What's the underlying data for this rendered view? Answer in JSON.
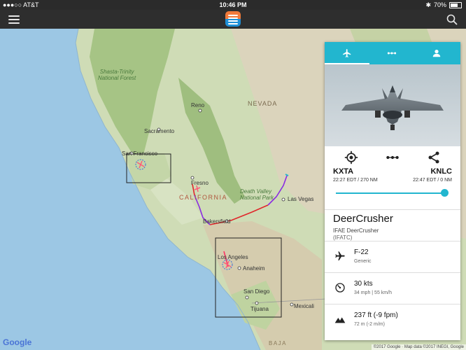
{
  "status_bar": {
    "carrier": "●●●○○ AT&T",
    "time": "10:46 PM",
    "battery": "70%",
    "battery_level": 0.7
  },
  "map": {
    "labels": {
      "shasta": "Shasta-Trinity\nNational Forest",
      "reno": "Reno",
      "nevada": "NEVADA",
      "sacramento": "Sacramento",
      "san_francisco": "San Francisco",
      "fresno": "Fresno",
      "california": "CALIFORNIA",
      "death_valley": "Death Valley\nNational Park",
      "las_vegas": "Las Vegas",
      "bakersfield": "Bakersfield",
      "los_angeles": "Los Angeles",
      "anaheim": "Anaheim",
      "san_diego": "San Diego",
      "tijuana": "Tijuana",
      "mexicali": "Mexicali",
      "baja": "BAJA"
    },
    "google_logo": "Google",
    "attribution": "©2017 Google · Map data ©2017 INEGI, Google"
  },
  "flight_card": {
    "tabs": [
      {
        "icon": "airplane-icon",
        "active": true
      },
      {
        "icon": "route-icon",
        "active": false
      },
      {
        "icon": "person-icon",
        "active": false
      }
    ],
    "route": {
      "origin_code": "KXTA",
      "origin_time": "22:27 EDT / 270 NM",
      "destination_code": "KNLC",
      "destination_time": "22:47 EDT / 0 NM",
      "progress": 0.97
    },
    "callsign": "DeerCrusher",
    "pilot": "IFAE DeerCrusher",
    "group": "(IFATC)",
    "aircraft": {
      "type": "F-22",
      "livery": "Generic"
    },
    "speed": {
      "primary": "30 kts",
      "secondary": "34 mph | 55 km/h"
    },
    "altitude": {
      "primary": "237 ft (-9 fpm)",
      "secondary": "72 m (-2 m/m)"
    }
  }
}
